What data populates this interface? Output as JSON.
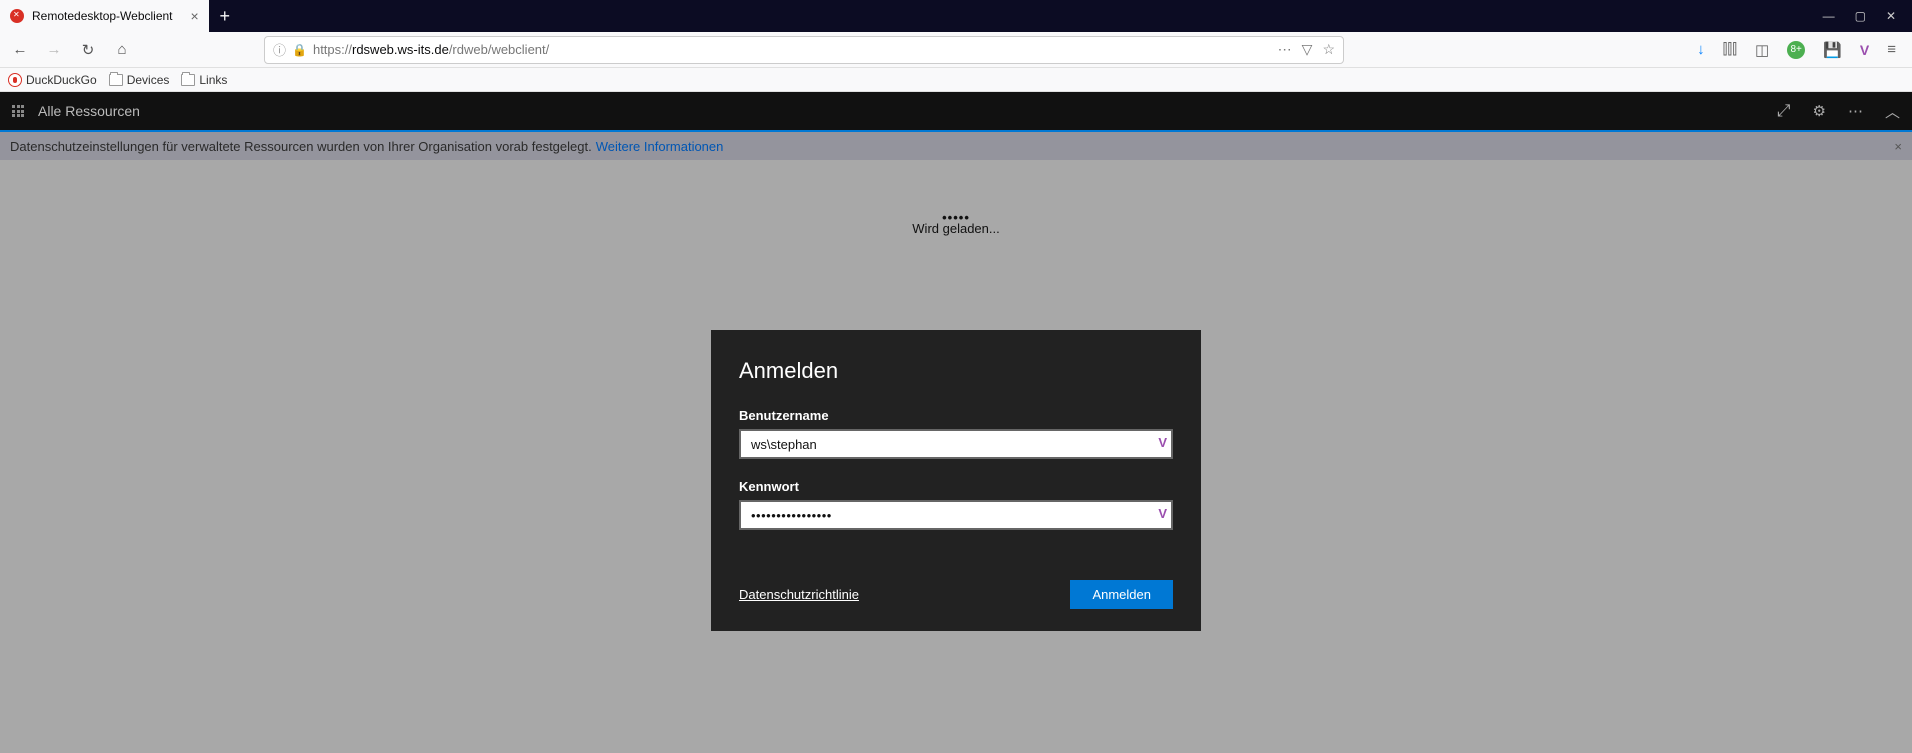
{
  "browser": {
    "tab_title": "Remotedesktop-Webclient",
    "url_proto": "https://",
    "url_domain": "rdsweb.ws-its.de",
    "url_path": "/rdweb/webclient/",
    "bookmarks": [
      "DuckDuckGo",
      "Devices",
      "Links"
    ]
  },
  "app": {
    "header_title": "Alle Ressourcen",
    "banner_text": "Datenschutzeinstellungen für verwaltete Ressourcen wurden von Ihrer Organisation vorab festgelegt.",
    "banner_link": "Weitere Informationen",
    "loading": "Wird geladen..."
  },
  "login": {
    "title": "Anmelden",
    "username_label": "Benutzername",
    "username_value": "ws\\stephan",
    "password_label": "Kennwort",
    "password_value": "••••••••••••••••",
    "privacy_link": "Datenschutzrichtlinie",
    "submit": "Anmelden"
  }
}
